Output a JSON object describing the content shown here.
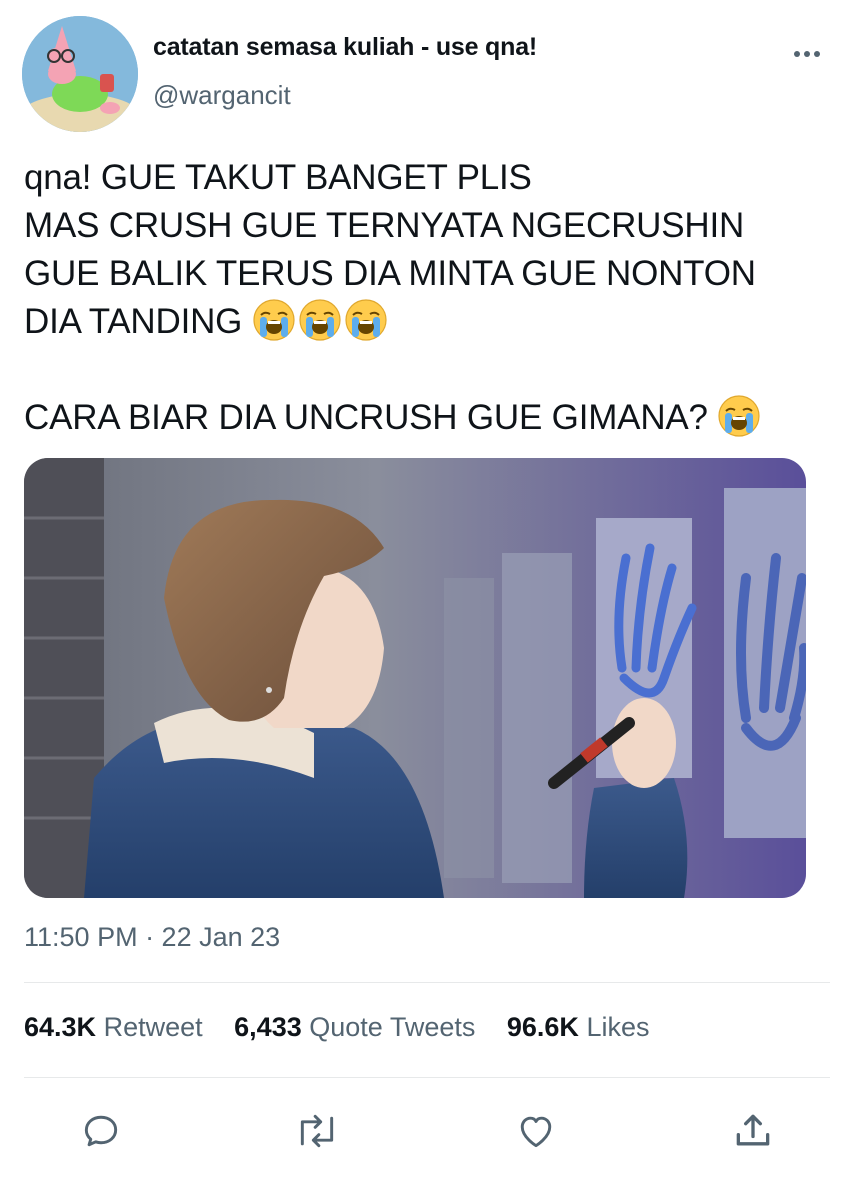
{
  "tweet": {
    "display_name": "catatan semasa kuliah - use qna!",
    "handle": "@wargancit",
    "text_lines": [
      "qna! GUE TAKUT BANGET PLIS",
      "MAS CRUSH GUE TERNYATA NGECRUSHIN",
      "GUE BALIK TERUS DIA MINTA GUE NONTON",
      "DIA TANDING",
      "CARA BIAR DIA UNCRUSH GUE GIMANA?"
    ],
    "emoji": "loudly-crying-face",
    "timestamp": "11:50 PM · 22 Jan 23"
  },
  "stats": {
    "retweets": {
      "value": "64.3K",
      "label": "Retweet"
    },
    "quotes": {
      "value": "6,433",
      "label": "Quote Tweets"
    },
    "likes": {
      "value": "96.6K",
      "label": "Likes"
    }
  },
  "icons": {
    "more": "more-horizontal-icon",
    "reply": "reply-icon",
    "retweet": "retweet-icon",
    "like": "heart-icon",
    "share": "share-icon"
  },
  "colors": {
    "text": "#0f1419",
    "secondary": "#536471",
    "divider": "#e7e9ea"
  }
}
